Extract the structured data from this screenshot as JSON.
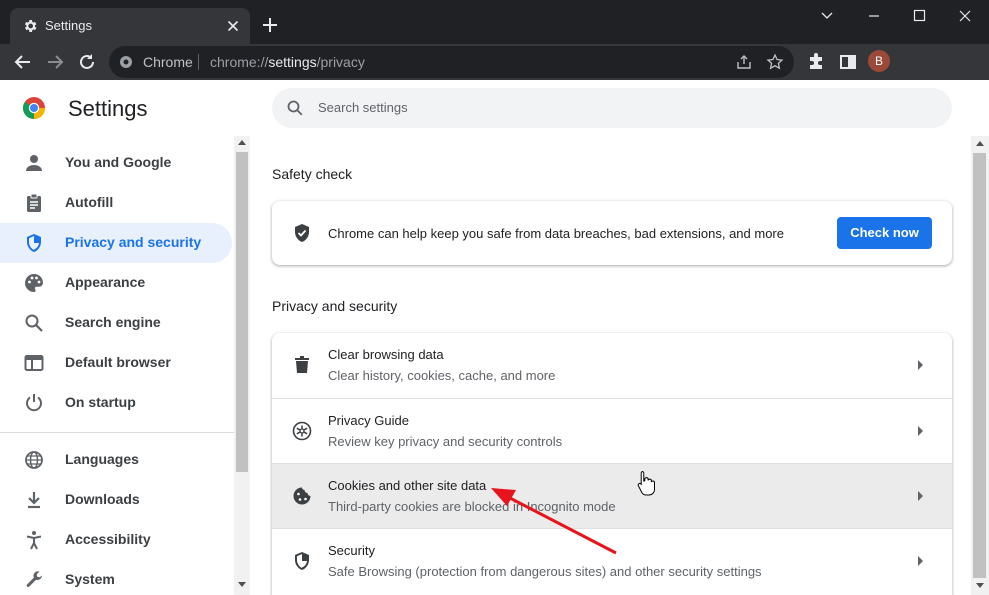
{
  "window": {
    "tab_title": "Settings",
    "tab_icon": "gear-icon"
  },
  "toolbar": {
    "site_label": "Chrome",
    "url_scheme": "chrome://",
    "url_host": "settings",
    "url_path": "/privacy",
    "profile_initial": "B"
  },
  "header": {
    "title": "Settings",
    "search_placeholder": "Search settings"
  },
  "sidebar": {
    "items": [
      {
        "label": "You and Google",
        "icon": "person-icon",
        "active": false
      },
      {
        "label": "Autofill",
        "icon": "clipboard-icon",
        "active": false
      },
      {
        "label": "Privacy and security",
        "icon": "shield-icon",
        "active": true
      },
      {
        "label": "Appearance",
        "icon": "palette-icon",
        "active": false
      },
      {
        "label": "Search engine",
        "icon": "search-icon",
        "active": false
      },
      {
        "label": "Default browser",
        "icon": "browser-window-icon",
        "active": false
      },
      {
        "label": "On startup",
        "icon": "power-icon",
        "active": false
      },
      {
        "label": "Languages",
        "icon": "globe-icon",
        "active": false
      },
      {
        "label": "Downloads",
        "icon": "download-icon",
        "active": false
      },
      {
        "label": "Accessibility",
        "icon": "accessibility-icon",
        "active": false
      },
      {
        "label": "System",
        "icon": "wrench-icon",
        "active": false
      }
    ]
  },
  "safety_check": {
    "section_title": "Safety check",
    "text": "Chrome can help keep you safe from data breaches, bad extensions, and more",
    "button_label": "Check now"
  },
  "privacy": {
    "section_title": "Privacy and security",
    "rows": [
      {
        "title": "Clear browsing data",
        "subtitle": "Clear history, cookies, cache, and more",
        "icon": "trash-icon"
      },
      {
        "title": "Privacy Guide",
        "subtitle": "Review key privacy and security controls",
        "icon": "privacy-guide-icon"
      },
      {
        "title": "Cookies and other site data",
        "subtitle": "Third-party cookies are blocked in Incognito mode",
        "icon": "cookie-icon"
      },
      {
        "title": "Security",
        "subtitle": "Safe Browsing (protection from dangerous sites) and other security settings",
        "icon": "shield-icon"
      }
    ]
  },
  "colors": {
    "accent": "#1a73e8",
    "active_nav_bg": "#e8f0fe",
    "annotation_arrow": "#e8141b",
    "titlebar": "#202124",
    "toolbar": "#35363a"
  }
}
